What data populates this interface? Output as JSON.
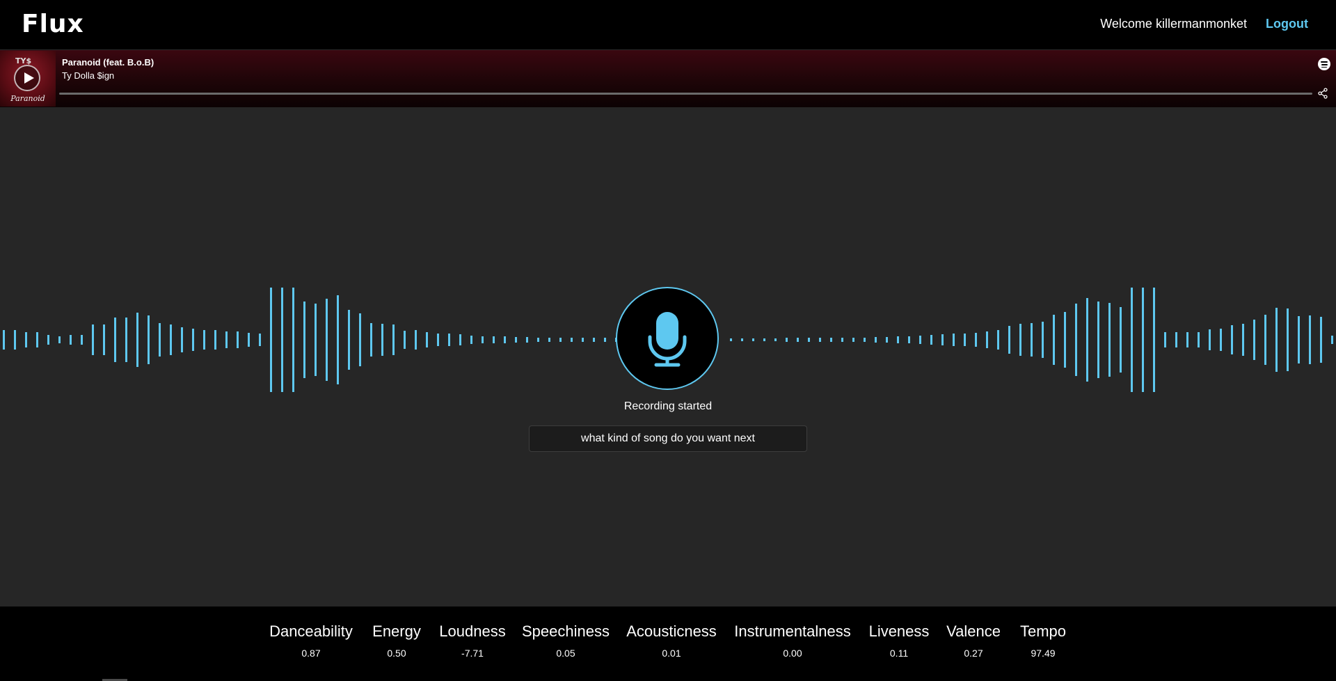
{
  "header": {
    "logo": "Flux",
    "welcome_text": "Welcome killermanmonket",
    "logout_label": "Logout"
  },
  "player": {
    "cover_caption": "Paranoid",
    "cover_mark": "TY$",
    "title": "Paranoid (feat. B.o.B)",
    "artist": "Ty Dolla $ign",
    "progress": 0.0
  },
  "voice": {
    "status": "Recording started",
    "prompt": "what kind of song do you want next"
  },
  "features": [
    {
      "name": "Danceability",
      "value": "0.87"
    },
    {
      "name": "Energy",
      "value": "0.50"
    },
    {
      "name": "Loudness",
      "value": "-7.71"
    },
    {
      "name": "Speechiness",
      "value": "0.05"
    },
    {
      "name": "Acousticness",
      "value": "0.01"
    },
    {
      "name": "Instrumentalness",
      "value": "0.00"
    },
    {
      "name": "Liveness",
      "value": "0.11"
    },
    {
      "name": "Valence",
      "value": "0.27"
    },
    {
      "name": "Tempo",
      "value": "97.49"
    }
  ],
  "colors": {
    "accent": "#5ec8f0",
    "background": "#262626",
    "bar": "#000000"
  },
  "icons": {
    "play": "play-icon",
    "spotify": "spotify-icon",
    "share": "share-icon",
    "mic": "microphone-icon"
  }
}
